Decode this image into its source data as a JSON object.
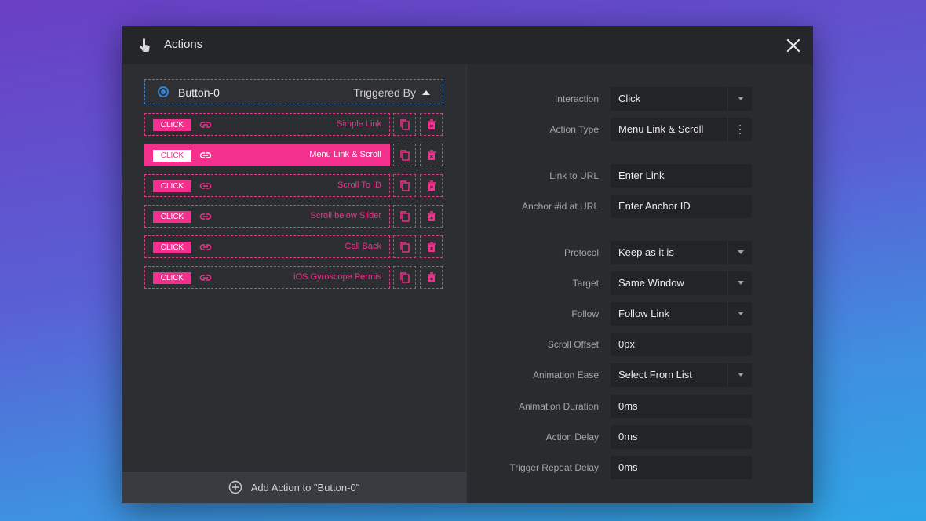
{
  "header": {
    "title": "Actions",
    "close_icon": "close-icon",
    "hand_icon": "hand-pointer-icon"
  },
  "layer": {
    "name": "Button-0",
    "triggered_by_label": "Triggered By"
  },
  "actions": [
    {
      "badge": "CLICK",
      "label": "Simple Link",
      "active": false
    },
    {
      "badge": "CLICK",
      "label": "Menu Link & Scroll",
      "active": true
    },
    {
      "badge": "CLICK",
      "label": "Scroll To ID",
      "active": false
    },
    {
      "badge": "CLICK",
      "label": "Scroll below Slider",
      "active": false
    },
    {
      "badge": "CLICK",
      "label": "Call Back",
      "active": false
    },
    {
      "badge": "CLICK",
      "label": "iOS Gyroscope Permis",
      "active": false
    }
  ],
  "add_action_label": "Add Action to \"Button-0\"",
  "fields": [
    {
      "label": "Interaction",
      "value": "Click",
      "control": "dropdown"
    },
    {
      "label": "Action Type",
      "value": "Menu Link & Scroll",
      "control": "menu"
    },
    {
      "label": "Link to URL",
      "value": "Enter Link",
      "control": "input"
    },
    {
      "label": "Anchor #id at URL",
      "value": "Enter Anchor ID",
      "control": "input"
    },
    {
      "label": "Protocol",
      "value": "Keep as it is",
      "control": "dropdown"
    },
    {
      "label": "Target",
      "value": "Same Window",
      "control": "dropdown"
    },
    {
      "label": "Follow",
      "value": "Follow Link",
      "control": "dropdown"
    },
    {
      "label": "Scroll Offset",
      "value": "0px",
      "control": "input"
    },
    {
      "label": "Animation Ease",
      "value": "Select From List",
      "control": "dropdown"
    },
    {
      "label": "Animation Duration",
      "value": "0ms",
      "control": "input"
    },
    {
      "label": "Action Delay",
      "value": "0ms",
      "control": "input"
    },
    {
      "label": "Trigger Repeat Delay",
      "value": "0ms",
      "control": "input"
    }
  ],
  "colors": {
    "accent": "#f3308e",
    "selection": "#2f86d8",
    "panel": "#2d2e32",
    "header": "#25262a"
  }
}
